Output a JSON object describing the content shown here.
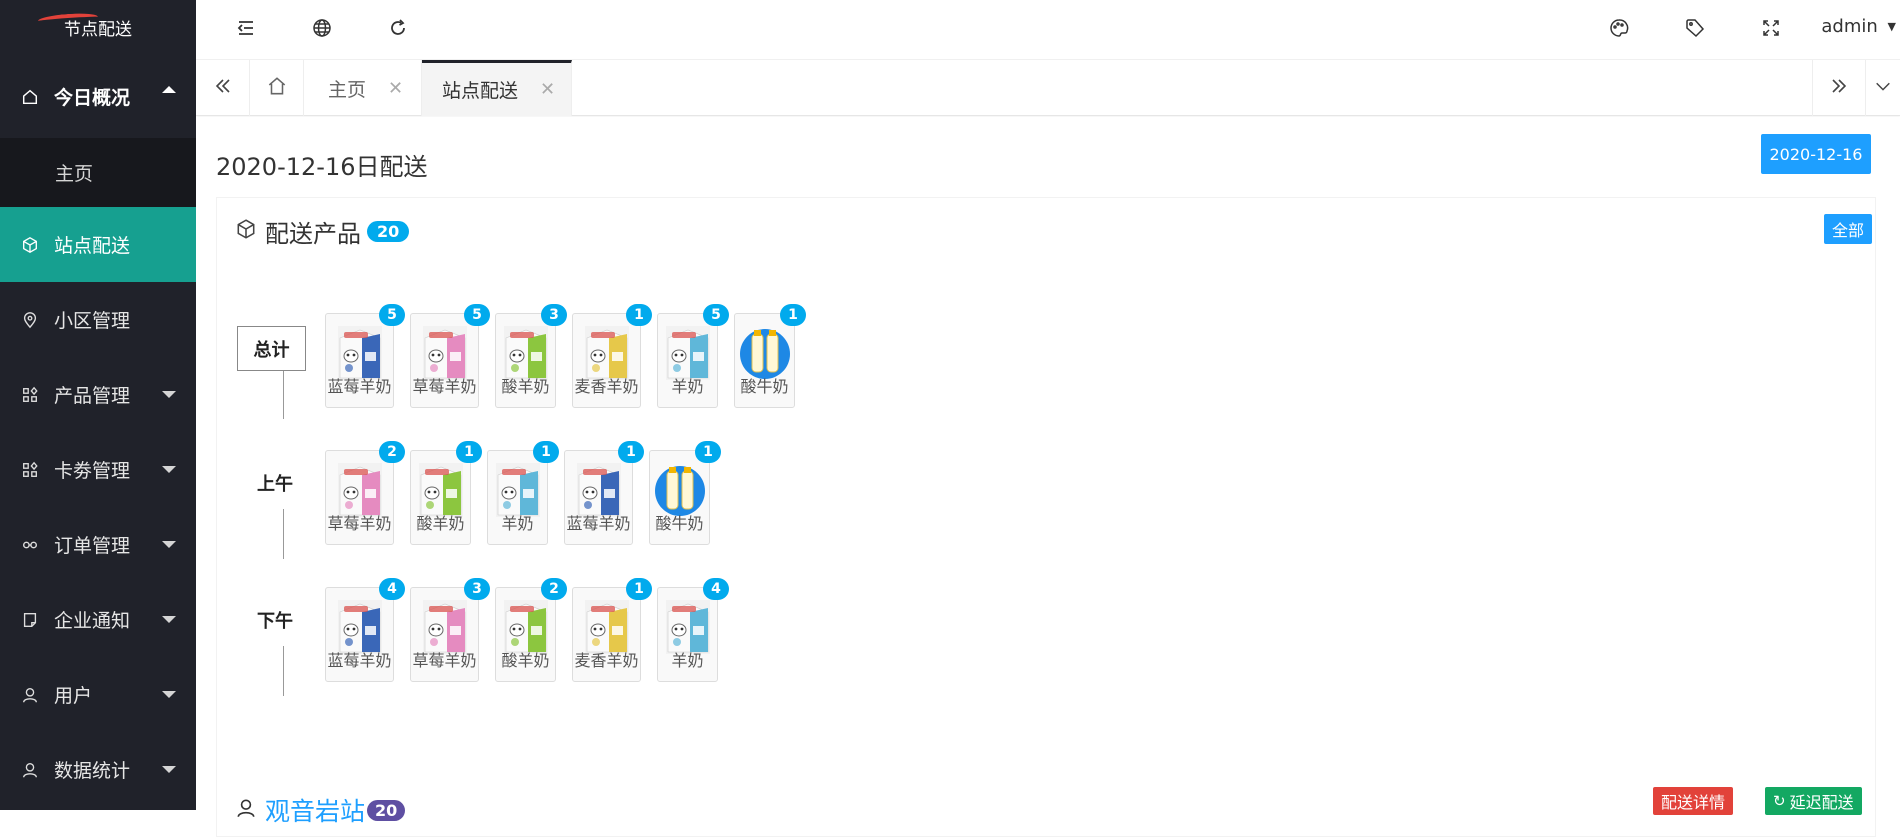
{
  "app": {
    "logo_text": "节点配送"
  },
  "sidebar": {
    "items": [
      {
        "label": "今日概况",
        "icon": "home-icon"
      },
      {
        "label": "主页"
      },
      {
        "label": "站点配送",
        "icon": "box-icon"
      },
      {
        "label": "小区管理",
        "icon": "location-icon"
      },
      {
        "label": "产品管理",
        "icon": "apps-icon"
      },
      {
        "label": "卡劵管理",
        "icon": "apps-icon"
      },
      {
        "label": "订单管理",
        "icon": "link-icon"
      },
      {
        "label": "企业通知",
        "icon": "note-icon"
      },
      {
        "label": "用户",
        "icon": "user-icon"
      },
      {
        "label": "数据统计",
        "icon": "user-icon"
      }
    ]
  },
  "header": {
    "user": "admin"
  },
  "tabs": [
    {
      "label": "主页"
    },
    {
      "label": "站点配送"
    }
  ],
  "page": {
    "title": "2020-12-16日配送",
    "date_button": "2020-12-16"
  },
  "section": {
    "title": "配送产品",
    "count": "20",
    "all_button": "全部"
  },
  "groups": [
    {
      "label": "总计",
      "products": [
        {
          "name": "蓝莓羊奶",
          "count": "5",
          "color": "#3a67b8"
        },
        {
          "name": "草莓羊奶",
          "count": "5",
          "color": "#e58bc0"
        },
        {
          "name": "酸羊奶",
          "count": "3",
          "color": "#8cc63f"
        },
        {
          "name": "麦香羊奶",
          "count": "1",
          "color": "#e6c84a"
        },
        {
          "name": "羊奶",
          "count": "5",
          "color": "#5fb7d9"
        },
        {
          "name": "酸牛奶",
          "count": "1",
          "color": "#1e88e5"
        }
      ]
    },
    {
      "label": "上午",
      "products": [
        {
          "name": "草莓羊奶",
          "count": "2",
          "color": "#e58bc0"
        },
        {
          "name": "酸羊奶",
          "count": "1",
          "color": "#8cc63f"
        },
        {
          "name": "羊奶",
          "count": "1",
          "color": "#5fb7d9"
        },
        {
          "name": "蓝莓羊奶",
          "count": "1",
          "color": "#3a67b8"
        },
        {
          "name": "酸牛奶",
          "count": "1",
          "color": "#1e88e5"
        }
      ]
    },
    {
      "label": "下午",
      "products": [
        {
          "name": "蓝莓羊奶",
          "count": "4",
          "color": "#3a67b8"
        },
        {
          "name": "草莓羊奶",
          "count": "3",
          "color": "#e58bc0"
        },
        {
          "name": "酸羊奶",
          "count": "2",
          "color": "#8cc63f"
        },
        {
          "name": "麦香羊奶",
          "count": "1",
          "color": "#e6c84a"
        },
        {
          "name": "羊奶",
          "count": "4",
          "color": "#5fb7d9"
        }
      ]
    }
  ],
  "station": {
    "name": "观音岩站",
    "count": "20",
    "detail_button": "配送详情",
    "delay_button": "延迟配送"
  }
}
